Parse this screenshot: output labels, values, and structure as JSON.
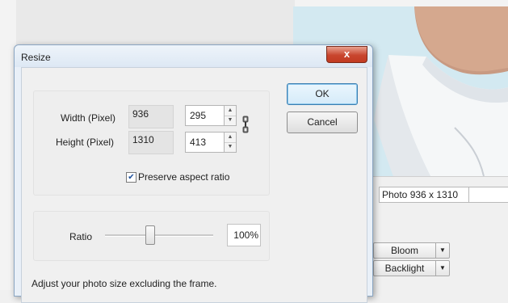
{
  "dialog": {
    "title": "Resize",
    "close_label": "x",
    "width_label": "Width (Pixel)",
    "height_label": "Height (Pixel)",
    "orig_width": "936",
    "orig_height": "1310",
    "new_width": "295",
    "new_height": "413",
    "preserve_label": "Preserve aspect ratio",
    "preserve_checked": true,
    "ratio_label": "Ratio",
    "ratio_value": "100%",
    "ratio_level": 0.4,
    "ok_label": "OK",
    "cancel_label": "Cancel",
    "footer_text": "Adjust your photo size excluding the frame."
  },
  "background": {
    "photo_info": "Photo 936 x 1310",
    "effect1": "Bloom",
    "effect2": "Backlight"
  },
  "icons": {
    "link": "chain-link-icon",
    "close": "close-icon",
    "spin_up": "arrow-up-icon",
    "spin_down": "arrow-down-icon",
    "dropdown": "chevron-down-icon"
  },
  "colors": {
    "close_button": "#c8452e",
    "default_button_border": "#3c7fb1",
    "checkmark": "#1c4f9c"
  }
}
